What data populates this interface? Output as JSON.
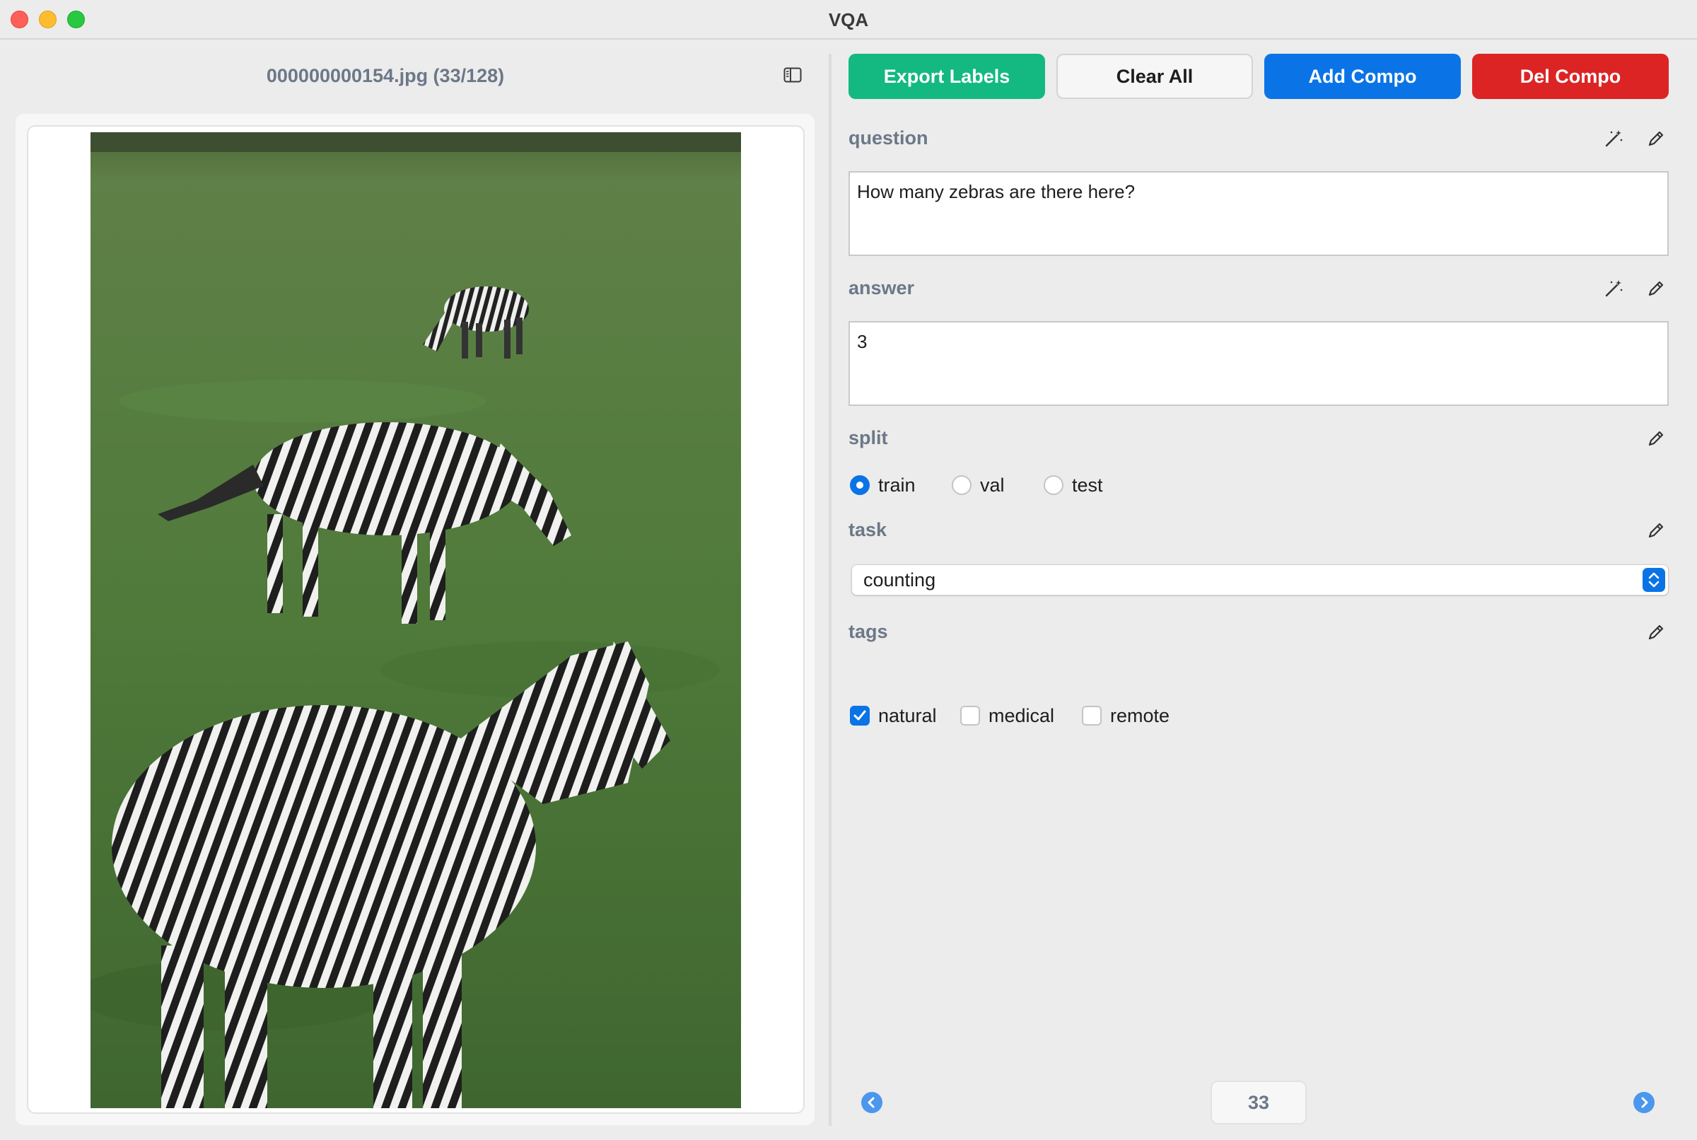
{
  "window": {
    "title": "VQA"
  },
  "left_panel": {
    "file_title": "000000000154.jpg (33/128)"
  },
  "toolbar": {
    "export_label": "Export Labels",
    "clear_label": "Clear All",
    "add_label": "Add Compo",
    "del_label": "Del Compo"
  },
  "question": {
    "label": "question",
    "value": "How many zebras are there here?"
  },
  "answer": {
    "label": "answer",
    "value": "3"
  },
  "split": {
    "label": "split",
    "options": [
      {
        "label": "train",
        "checked": true
      },
      {
        "label": "val",
        "checked": false
      },
      {
        "label": "test",
        "checked": false
      }
    ]
  },
  "task": {
    "label": "task",
    "selected": "counting"
  },
  "tags": {
    "label": "tags",
    "options": [
      {
        "label": "natural",
        "checked": true
      },
      {
        "label": "medical",
        "checked": false
      },
      {
        "label": "remote",
        "checked": false
      }
    ]
  },
  "pagination": {
    "current": "33"
  },
  "colors": {
    "export": "#13b981",
    "add": "#0a74e6",
    "del": "#dc2424",
    "label": "#6c7888",
    "accent": "#0a74e6"
  },
  "icons": [
    "sidebar-toggle-icon",
    "magic-wand-icon",
    "pencil-icon",
    "chevron-left-icon",
    "chevron-right-icon",
    "select-updown-icon",
    "checkmark-icon"
  ]
}
